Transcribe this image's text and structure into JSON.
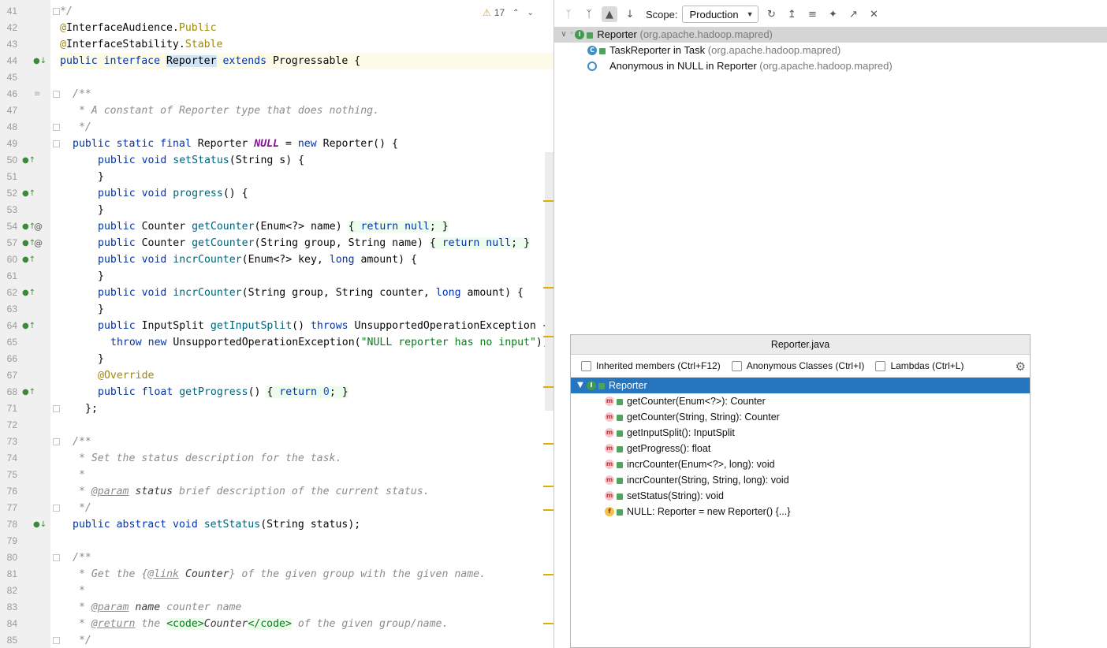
{
  "editor": {
    "inspection": {
      "warning_icon": "warning-triangle-icon",
      "warning_count": "17",
      "prev_icon": "chevron-up-icon",
      "next_icon": "chevron-down-icon"
    },
    "lines": [
      {
        "num": "41",
        "html": "<span class=\"cm\">*/</span>",
        "indent": 0,
        "icons": []
      },
      {
        "num": "42",
        "html": "<span class=\"ann\">@</span>InterfaceAudience.<span class=\"ann\">Public</span>",
        "indent": 0,
        "icons": []
      },
      {
        "num": "43",
        "html": "<span class=\"ann\">@</span>InterfaceStability.<span class=\"ann\">Stable</span>",
        "indent": 0,
        "icons": []
      },
      {
        "num": "44",
        "html": "<span class=\"kw\">public interface </span><span class=\"hl\">Reporter</span><span class=\"kw\"> extends </span>Progressable {",
        "indent": 0,
        "icons": [
          "impl-down"
        ],
        "current": true
      },
      {
        "num": "45",
        "html": "",
        "indent": 0,
        "icons": []
      },
      {
        "num": "46",
        "html": "<span class=\"cm\">/**</span>",
        "indent": 16,
        "icons": [
          "fold-list"
        ]
      },
      {
        "num": "47",
        "html": "<span class=\"cm\"> * A constant of Reporter type that does nothing.</span>",
        "indent": 16,
        "icons": []
      },
      {
        "num": "48",
        "html": "<span class=\"cm\"> */</span>",
        "indent": 16,
        "icons": []
      },
      {
        "num": "49",
        "html": "<span class=\"kw\">public static final </span>Reporter <span class=\"fld\">NULL</span> = <span class=\"kw\">new </span>Reporter() {",
        "indent": 16,
        "icons": []
      },
      {
        "num": "50",
        "html": "<span class=\"kw\">public void </span><span class=\"mth\">setStatus</span>(String s) {",
        "indent": 48,
        "icons": [
          "impl-up"
        ]
      },
      {
        "num": "51",
        "html": "}",
        "indent": 48,
        "icons": []
      },
      {
        "num": "52",
        "html": "<span class=\"kw\">public void </span><span class=\"mth\">progress</span>() {",
        "indent": 48,
        "icons": [
          "impl-up"
        ]
      },
      {
        "num": "53",
        "html": "}",
        "indent": 48,
        "icons": []
      },
      {
        "num": "54",
        "html": "<span class=\"kw\">public </span>Counter <span class=\"mth\">getCounter</span>(Enum&lt;?&gt; name) <span class=\"lb\">{ </span><span class=\"kw lb\">return null</span><span class=\"lb\">; }</span>",
        "indent": 48,
        "icons": [
          "impl-up",
          "at"
        ]
      },
      {
        "num": "57",
        "html": "<span class=\"kw\">public </span>Counter <span class=\"mth\">getCounter</span>(String group, String name) <span class=\"lb\">{ </span><span class=\"kw lb\">return null</span><span class=\"lb\">; }</span>",
        "indent": 48,
        "icons": [
          "impl-up",
          "at"
        ]
      },
      {
        "num": "60",
        "html": "<span class=\"kw\">public void </span><span class=\"mth\">incrCounter</span>(Enum&lt;?&gt; key, <span class=\"kw\">long </span>amount) {",
        "indent": 48,
        "icons": [
          "impl-up"
        ]
      },
      {
        "num": "61",
        "html": "}",
        "indent": 48,
        "icons": []
      },
      {
        "num": "62",
        "html": "<span class=\"kw\">public void </span><span class=\"mth\">incrCounter</span>(String group, String counter, <span class=\"kw\">long </span>amount) {",
        "indent": 48,
        "icons": [
          "impl-up"
        ]
      },
      {
        "num": "63",
        "html": "}",
        "indent": 48,
        "icons": []
      },
      {
        "num": "64",
        "html": "<span class=\"kw\">public </span>InputSplit <span class=\"mth\">getInputSplit</span>() <span class=\"kw\">throws </span>UnsupportedOperationException {",
        "indent": 48,
        "icons": [
          "impl-up"
        ]
      },
      {
        "num": "65",
        "html": "<span class=\"kw\">throw new </span>UnsupportedOperationException(<span class=\"str\">\"NULL reporter has no input\"</span>);",
        "indent": 64,
        "icons": []
      },
      {
        "num": "66",
        "html": "}",
        "indent": 48,
        "icons": []
      },
      {
        "num": "67",
        "html": "<span class=\"ann\">@Override</span>",
        "indent": 48,
        "icons": []
      },
      {
        "num": "68",
        "html": "<span class=\"kw\">public float </span><span class=\"mth\">getProgress</span>() <span class=\"lb\">{ </span><span class=\"kw lb\">return </span><span class=\"num lb\">0</span><span class=\"lb\">; }</span>",
        "indent": 48,
        "icons": [
          "impl-up"
        ]
      },
      {
        "num": "71",
        "html": "};",
        "indent": 32,
        "icons": []
      },
      {
        "num": "72",
        "html": "",
        "indent": 0,
        "icons": []
      },
      {
        "num": "73",
        "html": "<span class=\"cm\">/**</span>",
        "indent": 16,
        "icons": []
      },
      {
        "num": "74",
        "html": "<span class=\"cm\"> * Set the status description for the task.</span>",
        "indent": 16,
        "icons": []
      },
      {
        "num": "75",
        "html": "<span class=\"cm\"> *</span>",
        "indent": 16,
        "icons": []
      },
      {
        "num": "76",
        "html": "<span class=\"cm\"> * </span><span class=\"dt\">@param</span> <span class=\"dn\">status</span><span class=\"cm\"> brief description of the current status.</span>",
        "indent": 16,
        "icons": []
      },
      {
        "num": "77",
        "html": "<span class=\"cm\"> */</span>",
        "indent": 16,
        "icons": []
      },
      {
        "num": "78",
        "html": "<span class=\"kw\">public abstract void </span><span class=\"mth\">setStatus</span>(String status);",
        "indent": 16,
        "icons": [
          "impl-down"
        ]
      },
      {
        "num": "79",
        "html": "",
        "indent": 0,
        "icons": []
      },
      {
        "num": "80",
        "html": "<span class=\"cm\">/**</span>",
        "indent": 16,
        "icons": []
      },
      {
        "num": "81",
        "html": "<span class=\"cm\"> * Get the {</span><span class=\"dt\">@link</span> <span class=\"dn\">Counter</span><span class=\"cm\">} of the given group with the given name.</span>",
        "indent": 16,
        "icons": []
      },
      {
        "num": "82",
        "html": "<span class=\"cm\"> *</span>",
        "indent": 16,
        "icons": []
      },
      {
        "num": "83",
        "html": "<span class=\"cm\"> * </span><span class=\"dt\">@param</span> <span class=\"dn\">name</span><span class=\"cm\"> counter name</span>",
        "indent": 16,
        "icons": []
      },
      {
        "num": "84",
        "html": "<span class=\"cm\"> * </span><span class=\"dt\">@return</span><span class=\"cm\"> the </span><span class=\"code\">&lt;code&gt;</span><span class=\"dn\">Counter</span><span class=\"code\">&lt;/code&gt;</span><span class=\"cm\"> of the given group/name.</span>",
        "indent": 16,
        "icons": []
      },
      {
        "num": "85",
        "html": "<span class=\"cm\"> */</span>",
        "indent": 16,
        "icons": []
      }
    ]
  },
  "hierarchy": {
    "toolbar": {
      "scope_label": "Scope:",
      "scope_value": "Production",
      "buttons": [
        "subtypes-hierarchy-icon",
        "supertypes-hierarchy-icon",
        "class-hierarchy-icon",
        "sort-alpha-icon",
        "refresh-icon",
        "export-icon",
        "collapse-all-icon",
        "pin-icon",
        "open-in-window-icon",
        "close-icon"
      ]
    },
    "tree": [
      {
        "name": "Reporter",
        "pkg": "(org.apache.hadoop.mapred)",
        "icon": "interface-icon",
        "selected": true,
        "expanded": true,
        "level": 0
      },
      {
        "name": "TaskReporter in Task",
        "pkg": "(org.apache.hadoop.mapred)",
        "icon": "class-icon",
        "level": 1
      },
      {
        "name": "Anonymous in NULL in Reporter",
        "pkg": "(org.apache.hadoop.mapred)",
        "icon": "anonymous-class-icon",
        "level": 1
      }
    ]
  },
  "structure_popup": {
    "title": "Reporter.java",
    "options": [
      {
        "label": "Inherited members (Ctrl+F12)",
        "checked": false
      },
      {
        "label": "Anonymous Classes (Ctrl+I)",
        "checked": false
      },
      {
        "label": "Lambdas (Ctrl+L)",
        "checked": false
      }
    ],
    "root": {
      "name": "Reporter",
      "icon": "interface-icon"
    },
    "members": [
      {
        "label": "getCounter(Enum<?>): Counter",
        "icon": "method-icon"
      },
      {
        "label": "getCounter(String, String): Counter",
        "icon": "method-icon"
      },
      {
        "label": "getInputSplit(): InputSplit",
        "icon": "method-icon"
      },
      {
        "label": "getProgress(): float",
        "icon": "method-icon"
      },
      {
        "label": "incrCounter(Enum<?>, long): void",
        "icon": "method-icon"
      },
      {
        "label": "incrCounter(String, String, long): void",
        "icon": "method-icon"
      },
      {
        "label": "setStatus(String): void",
        "icon": "method-icon"
      },
      {
        "label": "NULL: Reporter = new Reporter() {...}",
        "icon": "field-icon"
      }
    ]
  },
  "colors": {
    "selection": "#2675bf",
    "keyword": "#0033b3",
    "annotation": "#9e880d",
    "string": "#067d17",
    "comment": "#8c8c8c"
  }
}
